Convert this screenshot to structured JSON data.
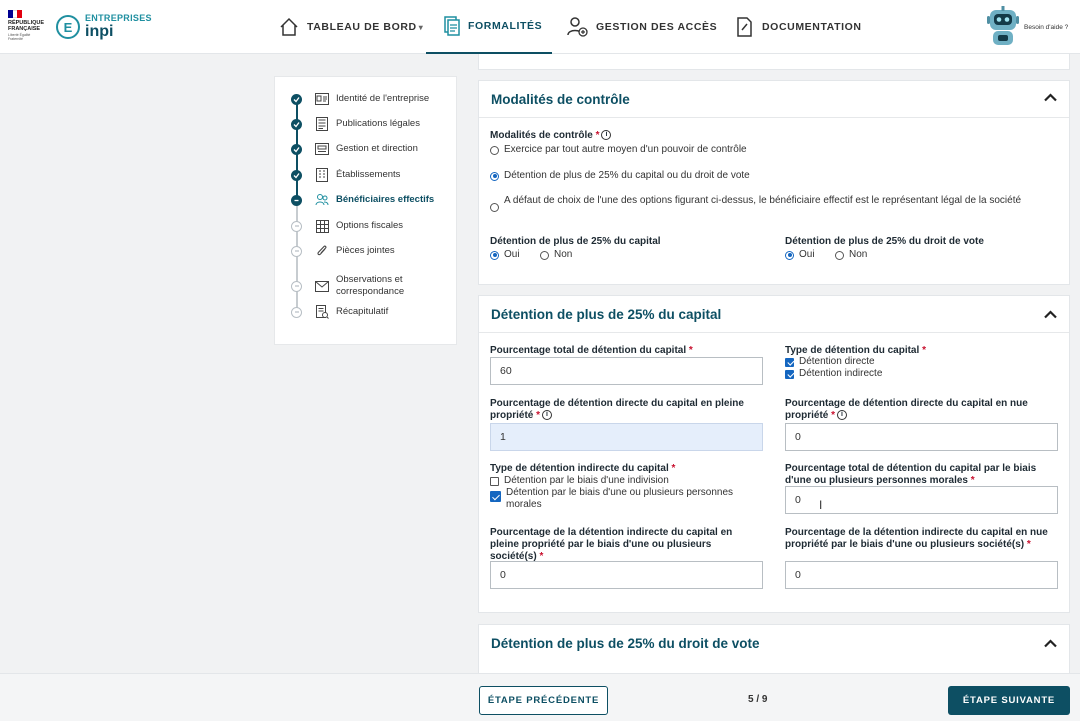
{
  "brand": {
    "republique_line1": "RÉPUBLIQUE",
    "republique_line2": "FRANÇAISE",
    "devise": "Liberté Égalité Fraternité",
    "inpi_small": "ENTREPRISES",
    "inpi_big": "inpi"
  },
  "nav": {
    "dashboard": "TABLEAU DE BORD",
    "formalities": "FORMALITÉS",
    "access": "GESTION DES ACCÈS",
    "docs": "DOCUMENTATION",
    "help": "Besoin d'aide ?"
  },
  "steps": [
    {
      "label": "Identité de l'entreprise",
      "state": "done"
    },
    {
      "label": "Publications légales",
      "state": "done"
    },
    {
      "label": "Gestion et direction",
      "state": "done"
    },
    {
      "label": "Établissements",
      "state": "done"
    },
    {
      "label": "Bénéficiaires effectifs",
      "state": "current"
    },
    {
      "label": "Options fiscales",
      "state": "todo"
    },
    {
      "label": "Pièces jointes",
      "state": "todo"
    },
    {
      "label": "Observations et correspondance",
      "state": "todo"
    },
    {
      "label": "Récapitulatif",
      "state": "todo"
    }
  ],
  "panel1": {
    "title": "Modalités de contrôle",
    "field_label": "Modalités de contrôle",
    "options": [
      "Exercice par tout autre moyen d'un pouvoir de contrôle",
      "Détention de plus de 25% du capital ou du droit de vote",
      "A défaut de choix de l'une des options figurant ci-dessus, le bénéficiaire effectif est le représentant légal de la société"
    ],
    "capital_label": "Détention de plus de 25% du capital",
    "vote_label": "Détention de plus de 25% du droit de vote",
    "yes": "Oui",
    "no": "Non"
  },
  "panel2": {
    "title": "Détention de plus de 25% du capital",
    "total_label": "Pourcentage total de détention du capital",
    "total_value": "60",
    "type_label": "Type de détention du capital",
    "type_direct": "Détention directe",
    "type_indirect": "Détention indirecte",
    "direct_pleine_label": "Pourcentage de détention directe du capital en pleine propriété",
    "direct_pleine_value": "1",
    "direct_nue_label": "Pourcentage de détention directe du capital en nue propriété",
    "direct_nue_value": "0",
    "indirect_type_label": "Type de détention indirecte du capital",
    "indirect_indivision": "Détention par le biais d'une indivision",
    "indirect_morales": "Détention par le biais d'une ou plusieurs personnes morales",
    "total_morales_label": "Pourcentage total de détention du capital par le biais d'une ou plusieurs personnes morales",
    "total_morales_value": "0",
    "indirect_pleine_label": "Pourcentage de la détention indirecte du capital en pleine propriété par le biais d'une ou plusieurs société(s)",
    "indirect_pleine_value": "0",
    "indirect_nue_label": "Pourcentage de la détention indirecte du capital en nue propriété par le biais d'une ou plusieurs société(s)",
    "indirect_nue_value": "0"
  },
  "panel3": {
    "title": "Détention de plus de 25% du droit de vote"
  },
  "footer": {
    "prev": "ÉTAPE PRÉCÉDENTE",
    "pager": "5 / 9",
    "next": "ÉTAPE SUIVANTE"
  },
  "colors": {
    "primary": "#0d4f63",
    "accent": "#1f8fa0",
    "checked": "#1466c0",
    "required": "#c8102e"
  }
}
